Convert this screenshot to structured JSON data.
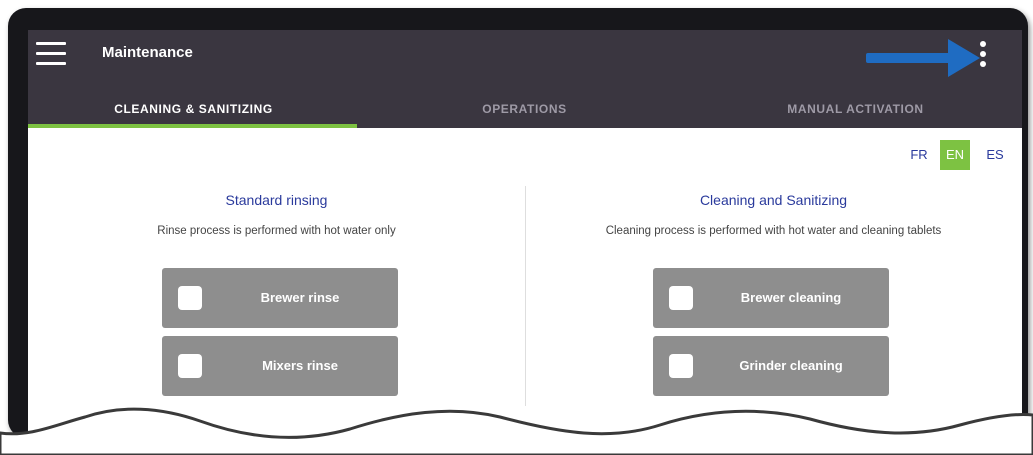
{
  "appbar": {
    "title": "Maintenance"
  },
  "tabs": [
    {
      "label": "CLEANING & SANITIZING",
      "active": true
    },
    {
      "label": "OPERATIONS",
      "active": false
    },
    {
      "label": "MANUAL ACTIVATION",
      "active": false
    }
  ],
  "languages": [
    {
      "code": "FR",
      "active": false
    },
    {
      "code": "EN",
      "active": true
    },
    {
      "code": "ES",
      "active": false
    }
  ],
  "panels": {
    "left": {
      "title": "Standard rinsing",
      "description": "Rinse process is performed with hot water only",
      "options": [
        {
          "label": "Brewer rinse",
          "checked": false
        },
        {
          "label": "Mixers rinse",
          "checked": false
        }
      ]
    },
    "right": {
      "title": "Cleaning and Sanitizing",
      "description": "Cleaning process is performed with hot water and cleaning tablets",
      "options": [
        {
          "label": "Brewer cleaning",
          "checked": false
        },
        {
          "label": "Grinder cleaning",
          "checked": false
        }
      ]
    }
  },
  "colors": {
    "appbar": "#3a3640",
    "accent": "#7dc242",
    "link": "#2a3a9c",
    "option_bg": "#8e8e8e",
    "annotation_arrow": "#1f6cc2"
  },
  "icons": {
    "menu": "hamburger-menu-icon",
    "overflow": "more-vertical-icon",
    "annotation": "pointer-arrow-icon"
  }
}
